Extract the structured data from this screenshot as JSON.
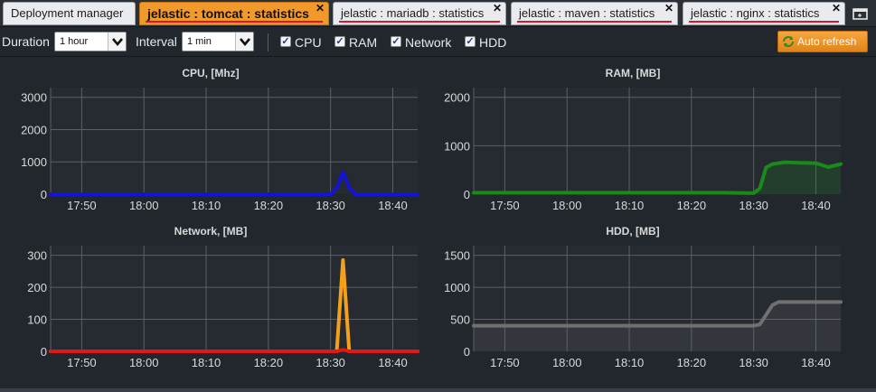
{
  "tabs": [
    {
      "label": "Deployment manager",
      "closable": false,
      "active": false
    },
    {
      "label": "jelastic : tomcat : statistics",
      "closable": true,
      "active": true
    },
    {
      "label": "jelastic : mariadb : statistics",
      "closable": true,
      "active": false
    },
    {
      "label": "jelastic : maven : statistics",
      "closable": true,
      "active": false
    },
    {
      "label": "jelastic : nginx : statistics",
      "closable": true,
      "active": false
    }
  ],
  "toolbar": {
    "duration_label": "Duration",
    "duration_value": "1 hour",
    "interval_label": "Interval",
    "interval_value": "1 min",
    "checkboxes": [
      {
        "label": "CPU",
        "checked": true
      },
      {
        "label": "RAM",
        "checked": true
      },
      {
        "label": "Network",
        "checked": true
      },
      {
        "label": "HDD",
        "checked": true
      }
    ],
    "auto_refresh_label": "Auto refresh"
  },
  "colors": {
    "active_tab": "#f19a2b",
    "tab_underline": "#e0142a",
    "cpu_series": "#1414d8",
    "ram_series": "#1a8a1a",
    "network_series_1": "#f5a01a",
    "network_series_2": "#e01818",
    "hdd_series": "#707070"
  },
  "chart_data": [
    {
      "type": "line",
      "title": "CPU, [Mhz]",
      "x": [
        "17:45",
        "17:50",
        "17:55",
        "18:00",
        "18:05",
        "18:10",
        "18:15",
        "18:20",
        "18:25",
        "18:30",
        "18:31",
        "18:32",
        "18:33",
        "18:34",
        "18:35",
        "18:40",
        "18:44"
      ],
      "series": [
        {
          "values": [
            0,
            0,
            0,
            0,
            0,
            0,
            0,
            0,
            0,
            0,
            200,
            680,
            200,
            0,
            0,
            0,
            0
          ],
          "color": "#1414d8"
        }
      ],
      "xticks": [
        "17:50",
        "18:00",
        "18:10",
        "18:20",
        "18:30",
        "18:40"
      ],
      "yticks": [
        0,
        1000,
        2000,
        3000
      ],
      "ylim": [
        0,
        3300
      ],
      "grid": true
    },
    {
      "type": "area",
      "title": "RAM, [MB]",
      "x": [
        "17:45",
        "17:50",
        "17:55",
        "18:00",
        "18:05",
        "18:10",
        "18:15",
        "18:20",
        "18:25",
        "18:30",
        "18:31",
        "18:32",
        "18:33",
        "18:35",
        "18:37",
        "18:40",
        "18:42",
        "18:44"
      ],
      "series": [
        {
          "values": [
            30,
            30,
            30,
            30,
            30,
            30,
            30,
            30,
            30,
            20,
            120,
            550,
            620,
            660,
            650,
            640,
            560,
            620
          ],
          "color": "#1a8a1a"
        }
      ],
      "xticks": [
        "17:50",
        "18:00",
        "18:10",
        "18:20",
        "18:30",
        "18:40"
      ],
      "yticks": [
        0,
        1000,
        2000
      ],
      "ylim": [
        0,
        2200
      ],
      "grid": true
    },
    {
      "type": "line",
      "title": "Network, [MB]",
      "x": [
        "17:45",
        "17:50",
        "18:00",
        "18:10",
        "18:20",
        "18:30",
        "18:31",
        "18:32",
        "18:33",
        "18:40",
        "18:44"
      ],
      "series": [
        {
          "values": [
            0,
            0,
            0,
            0,
            0,
            0,
            0,
            285,
            0,
            0,
            0
          ],
          "color": "#f5a01a"
        },
        {
          "values": [
            0,
            0,
            0,
            0,
            0,
            0,
            0,
            5,
            0,
            0,
            0
          ],
          "color": "#e01818"
        }
      ],
      "xticks": [
        "17:50",
        "18:00",
        "18:10",
        "18:20",
        "18:30",
        "18:40"
      ],
      "yticks": [
        0,
        100,
        200,
        300
      ],
      "ylim": [
        0,
        330
      ],
      "grid": true
    },
    {
      "type": "area",
      "title": "HDD, [MB]",
      "x": [
        "17:45",
        "17:50",
        "18:00",
        "18:10",
        "18:20",
        "18:30",
        "18:31",
        "18:33",
        "18:34",
        "18:40",
        "18:44"
      ],
      "series": [
        {
          "values": [
            400,
            400,
            400,
            400,
            400,
            400,
            420,
            720,
            770,
            770,
            770
          ],
          "color": "#707070"
        }
      ],
      "xticks": [
        "17:50",
        "18:00",
        "18:10",
        "18:20",
        "18:30",
        "18:40"
      ],
      "yticks": [
        0,
        500,
        1000,
        1500
      ],
      "ylim": [
        0,
        1650
      ],
      "grid": true
    }
  ]
}
